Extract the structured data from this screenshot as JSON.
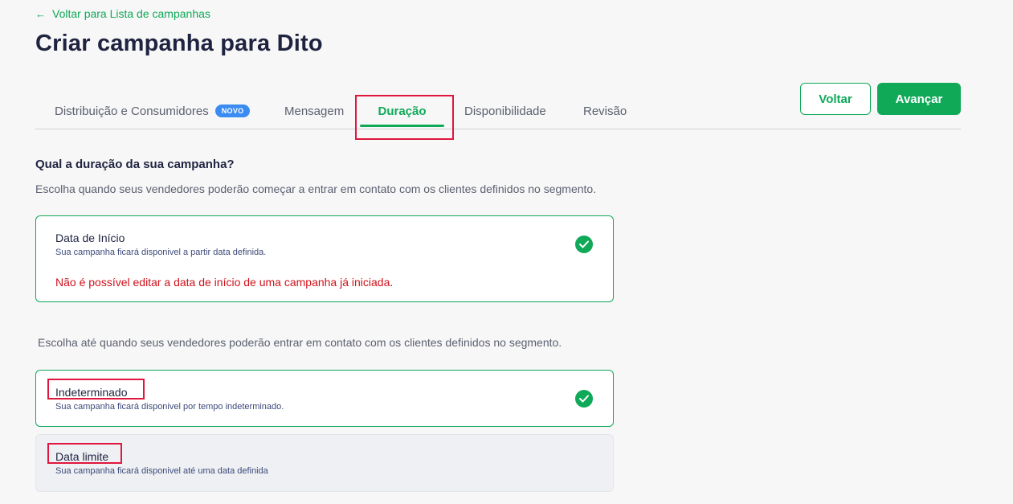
{
  "header": {
    "back_link": "Voltar para Lista de campanhas",
    "title": "Criar campanha para Dito"
  },
  "tabs": [
    {
      "label": "Distribuição e Consumidores",
      "badge": "NOVO"
    },
    {
      "label": "Mensagem"
    },
    {
      "label": "Duração",
      "active": true
    },
    {
      "label": "Disponibilidade"
    },
    {
      "label": "Revisão"
    }
  ],
  "actions": {
    "back_label": "Voltar",
    "next_label": "Avançar"
  },
  "duration": {
    "heading": "Qual a duração da sua campanha?",
    "start_prompt": "Escolha quando seus vendedores poderão começar a entrar em contato com os clientes definidos no segmento.",
    "start_card": {
      "title": "Data de Início",
      "subtitle": "Sua campanha ficará disponivel a partir data definida.",
      "error": "Não é possível editar a data de início de uma campanha já iniciada."
    },
    "end_prompt": "Escolha até quando seus vendedores poderão entrar em contato com os clientes definidos no segmento.",
    "options": [
      {
        "title": "Indeterminado",
        "subtitle": "Sua campanha ficará disponivel por tempo indeterminado.",
        "selected": true
      },
      {
        "title": "Data limite",
        "subtitle": "Sua campanha ficará disponivel até uma data definida",
        "selected": false
      }
    ]
  },
  "colors": {
    "accent": "#0fa958",
    "highlight": "#e0163d",
    "error": "#d0111b",
    "badge": "#3b8cf2"
  }
}
